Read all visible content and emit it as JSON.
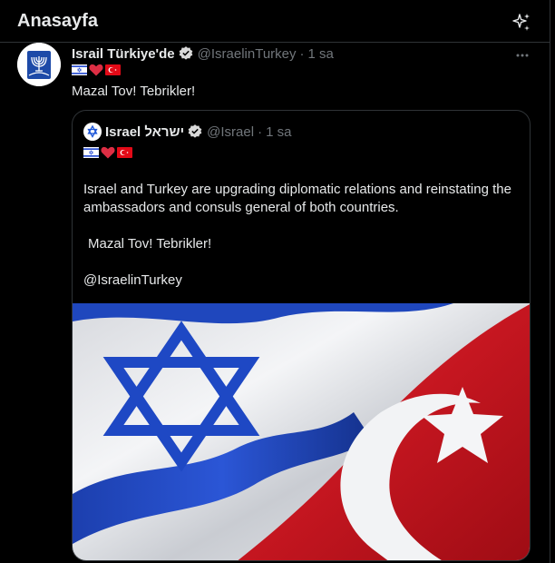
{
  "header": {
    "title": "Anasayfa",
    "sparkle_icon": "sparkle-icon"
  },
  "tweet": {
    "author_name": "Israil Türkiye'de",
    "handle": "@IsraelinTurkey",
    "separator": "·",
    "time": "1 sa",
    "text": "Mazal Tov! Tebrikler!",
    "icons": [
      "israel-flag-icon",
      "heart-icon",
      "turkey-flag-icon"
    ]
  },
  "quote": {
    "author_name": "Israel ישראל",
    "handle": "@Israel",
    "separator": "·",
    "time": "1 sa",
    "paragraph1": "Israel and Turkey are upgrading diplomatic relations and reinstating the ambassadors and consuls general of both countries.",
    "paragraph2": "Mazal Tov! Tebrikler!",
    "paragraph3": "@IsraelinTurkey"
  },
  "colors": {
    "background": "#000000",
    "text": "#e7e9ea",
    "muted": "#71767b",
    "border": "#2f3336",
    "verified": "#d9d9d9"
  }
}
